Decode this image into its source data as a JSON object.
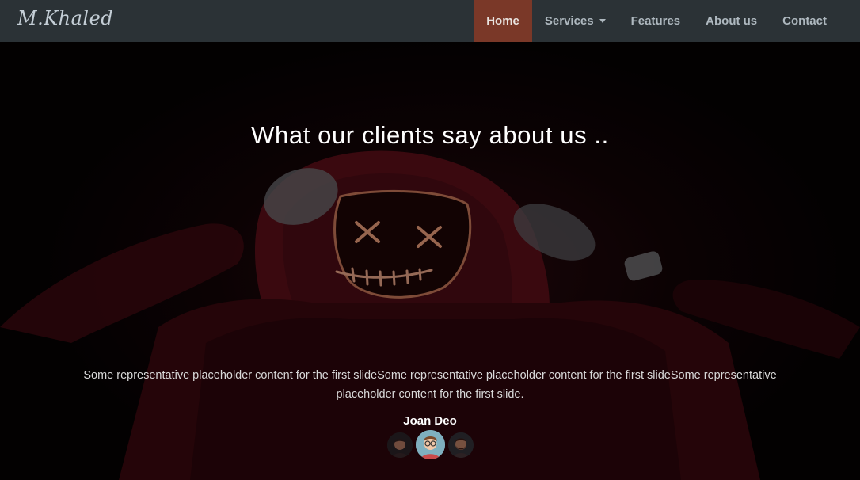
{
  "brand": "M.Khaled",
  "nav": {
    "home": "Home",
    "services": "Services",
    "features": "Features",
    "about": "About us",
    "contact": "Contact"
  },
  "testimonials": {
    "heading": "What our clients say about us ..",
    "quote": "Some representative placeholder content for the first slideSome representative placeholder content for the first slideSome representative placeholder content for the first slide.",
    "author": "Joan Deo",
    "avatars": [
      "avatar-dark-hair",
      "avatar-glasses",
      "avatar-beard"
    ],
    "active_avatar_index": 1
  },
  "colors": {
    "navbar": "#2b3236",
    "active_nav": "#7a3828",
    "hoodie": "#6a111c",
    "mask_glow": "#d98a6a"
  }
}
